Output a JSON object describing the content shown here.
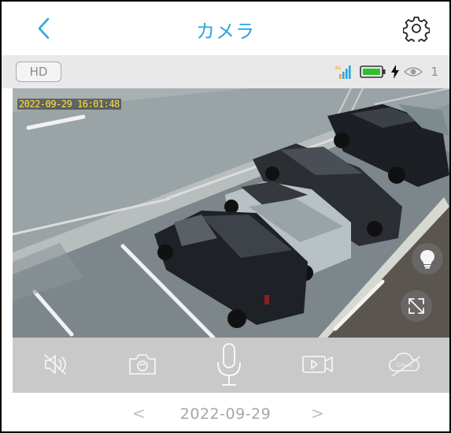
{
  "header": {
    "title": "カメラ",
    "accent_color": "#2ba6dd",
    "back_icon": "chevron-left-icon",
    "settings_icon": "gear-icon"
  },
  "status_bar": {
    "quality_label": "HD",
    "network_badge": "4G",
    "signal_icon": "signal-bars-icon",
    "battery_icon": "battery-charging-icon",
    "charging_icon": "lightning-icon",
    "viewers_icon": "eye-icon",
    "viewer_count": "1",
    "battery_color": "#2ec12e"
  },
  "video": {
    "timestamp": "2022-09-29 16:01:48",
    "timestamp_color": "#ffe23d",
    "light_button_icon": "light-bulb-icon",
    "fullscreen_button_icon": "fullscreen-icon"
  },
  "controls": {
    "items": [
      {
        "name": "mute",
        "icon": "speaker-muted-icon"
      },
      {
        "name": "snapshot",
        "icon": "camera-icon"
      },
      {
        "name": "talk",
        "icon": "microphone-icon"
      },
      {
        "name": "record",
        "icon": "video-record-icon"
      },
      {
        "name": "cloud",
        "icon": "cloud-off-icon",
        "label": "Cloud"
      }
    ]
  },
  "date_nav": {
    "date": "2022-09-29",
    "prev_symbol": "<",
    "next_symbol": ">"
  }
}
